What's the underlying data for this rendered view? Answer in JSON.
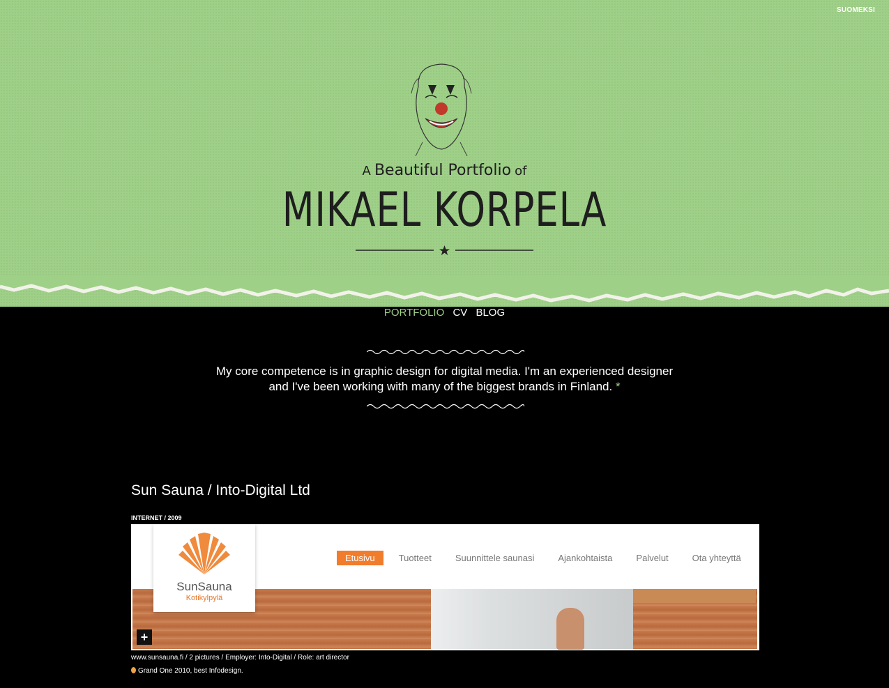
{
  "header": {
    "language_link": "SUOMEKSI",
    "subtitle_a": "A",
    "subtitle_main": "Beautiful Portfolio",
    "subtitle_of": "of",
    "name": "MIKAEL KORPELA",
    "background_color": "#9fd088"
  },
  "nav": {
    "items": [
      {
        "label": "PORTFOLIO",
        "active": true
      },
      {
        "label": "CV",
        "active": false
      },
      {
        "label": "BLOG",
        "active": false
      }
    ],
    "active_color": "#9fd088"
  },
  "intro": {
    "text": "My core competence is in graphic design for digital media. I'm an experienced designer and I've been working with many of the biggest brands in Finland.",
    "footnote": "*"
  },
  "project": {
    "title": "Sun Sauna / Into-Digital Ltd",
    "meta": "INTERNET / 2009",
    "screenshot": {
      "brand": "SunSauna",
      "tagline": "Kotikylpylä",
      "site_nav": [
        "Etusivu",
        "Tuotteet",
        "Suunnittele saunasi",
        "Ajankohtaista",
        "Palvelut",
        "Ota yhteyttä"
      ],
      "zoom_icon": "plus-icon",
      "accent_color": "#f07c2c"
    },
    "caption": "www.sunsauna.fi / 2 pictures / Employer: Into-Digital / Role: art director",
    "award": "Grand One 2010, best Infodesign."
  }
}
